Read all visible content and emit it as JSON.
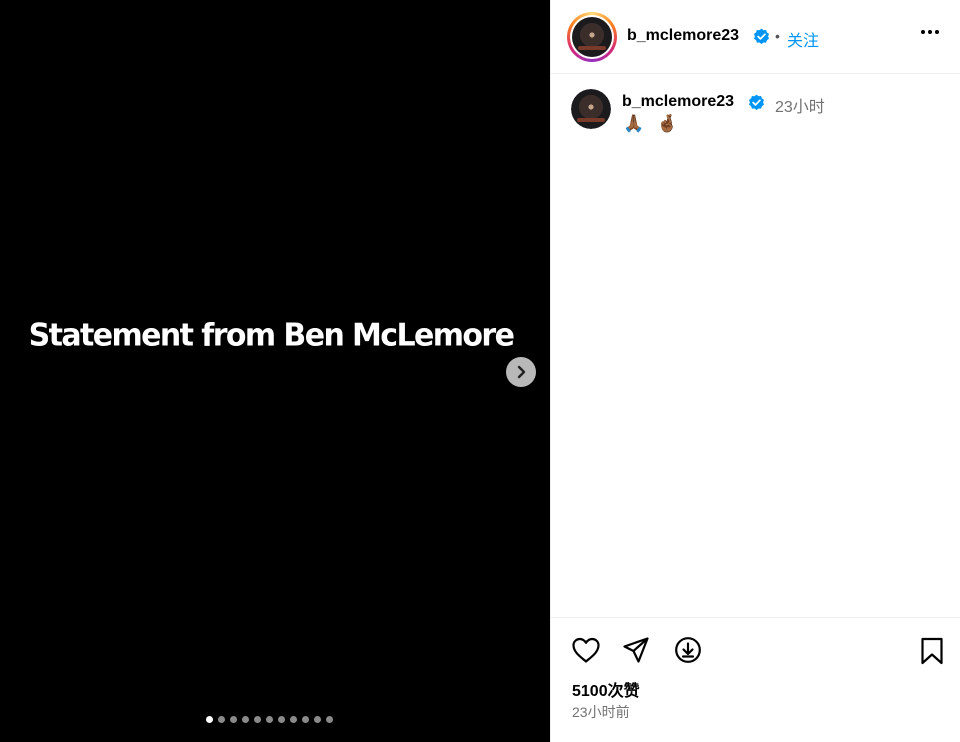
{
  "media": {
    "caption": "Statement from Ben McLemore",
    "carousel_count": 11,
    "carousel_active": 0
  },
  "header": {
    "username": "b_mclemore23",
    "separator": "•",
    "follow_label": "关注"
  },
  "comment": {
    "username": "b_mclemore23",
    "time": "23小时",
    "text": "🙏🏾 🤞🏾"
  },
  "footer": {
    "likes": "5100次赞",
    "time": "23小时前"
  },
  "colors": {
    "accent": "#0095f6",
    "verified": "#0095f6",
    "muted": "#737373"
  }
}
